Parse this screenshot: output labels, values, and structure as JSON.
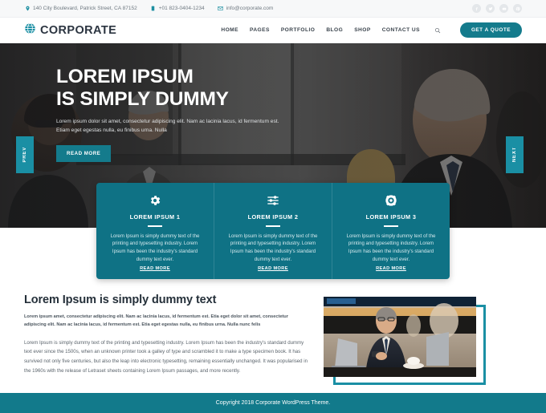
{
  "topbar": {
    "address": "140 City Boulevard, Patrick Street, CA 87152",
    "phone": "+01 823-0404-1234",
    "email": "info@corporate.com",
    "socials": [
      {
        "name": "facebook-icon",
        "label": "f"
      },
      {
        "name": "twitter-icon",
        "label": "t"
      },
      {
        "name": "youtube-icon",
        "label": "yt"
      },
      {
        "name": "pinterest-icon",
        "label": "p"
      }
    ]
  },
  "nav": {
    "brand": "CORPORATE",
    "links": [
      "HOME",
      "PAGES",
      "PORTFOLIO",
      "BLOG",
      "SHOP",
      "CONTACT US"
    ],
    "cta": "GET A QUOTE",
    "search_icon": "search-icon"
  },
  "hero": {
    "title_line1": "LOREM IPSUM",
    "title_line2": "IS SIMPLY DUMMY",
    "subtitle": "Lorem ipsum dolor sit amet, consectetur adipiscing elit. Nam ac lacinia lacus, id fermentum est. Etiam eget egestas nulla, eu finibus urna. Nulla",
    "button": "READ MORE",
    "prev": "PREV",
    "next": "NEXT"
  },
  "cards": [
    {
      "icon": "gear-icon",
      "title": "LOREM IPSUM 1",
      "text": "Lorem Ipsum is simply dummy text of the printing and typesetting industry. Lorem Ipsum has been the industry's standard dummy text ever.",
      "more": "READ MORE"
    },
    {
      "icon": "sliders-icon",
      "title": "LOREM IPSUM 2",
      "text": "Lorem Ipsum is simply dummy text of the printing and typesetting industry. Lorem Ipsum has been the industry's standard dummy text ever.",
      "more": "READ MORE"
    },
    {
      "icon": "lifebuoy-icon",
      "title": "LOREM IPSUM 3",
      "text": "Lorem Ipsum is simply dummy text of the printing and typesetting industry. Lorem Ipsum has been the industry's standard dummy text ever.",
      "more": "READ MORE"
    }
  ],
  "content": {
    "title": "Lorem Ipsum is simply dummy text",
    "lead": "Lorem ipsum  amet, consectetur adipiscing elit. Nam ac lacinia lacus, id fermentum est. Etia  eget dolor sit amet, consectetur adipiscing elit. Nam ac lacinia lacus, id fermentum est. Etia  eget egestas nulla, eu finibus urna. Nulla nunc felis",
    "body": "Lorem Ipsum is simply dummy text of the printing and typesetting industry. Lorem Ipsum has been the industry's standard dummy text ever since the 1500s, when an unknown printer took a galley of type and scrambled it to make a type specimen book. It has survived not only five centuries, but also the leap into electronic typesetting, remaining essentially unchanged. It was popularised in the 1960s with the release of Letraset sheets containing Lorem Ipsum passages, and more recently.",
    "image_alt": "businessman-with-laptop-photo"
  },
  "footer": {
    "copyright": "Copyright 2018 Corporate WordPress Theme."
  },
  "colors": {
    "accent": "#1a8fa4",
    "accent_dark": "#0f7285",
    "button": "#147b8c",
    "footer": "#127a8b",
    "heading": "#25303a"
  }
}
